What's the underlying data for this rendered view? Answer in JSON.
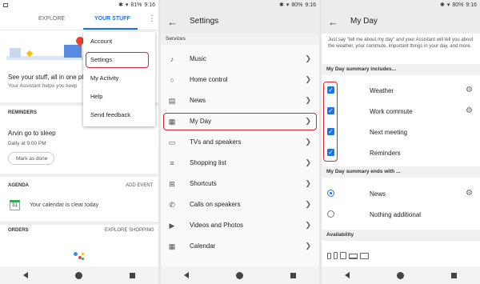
{
  "status_left": {
    "time": "9:16",
    "battery": "81%"
  },
  "status_mid": {
    "time": "9:16",
    "battery": "80%"
  },
  "status_right": {
    "time": "9:16",
    "battery": "80%"
  },
  "phone1": {
    "tabs": [
      "EXPLORE",
      "YOUR STUFF"
    ],
    "hero_text": "See your stuff, all in one pla",
    "hero_sub": "Your Assistant helps you keep",
    "reminders_title": "REMINDERS",
    "reminder_title": "Arvin go to sleep",
    "reminder_time": "Daily at 9:00 PM",
    "mark_done": "Mark as done",
    "agenda_title": "AGENDA",
    "add_event": "ADD EVENT",
    "calendar_day": "31",
    "calendar_clear": "Your calendar is clear today",
    "orders_title": "ORDERS",
    "explore_shopping": "EXPLORE SHOPPING",
    "menu": [
      "Account",
      "Settings",
      "My Activity",
      "Help",
      "Send feedback"
    ]
  },
  "phone2": {
    "title": "Settings",
    "section": "Services",
    "items": [
      {
        "label": "Music",
        "icon": "music-note"
      },
      {
        "label": "Home control",
        "icon": "lightbulb"
      },
      {
        "label": "News",
        "icon": "newspaper"
      },
      {
        "label": "My Day",
        "icon": "calendar-day"
      },
      {
        "label": "TVs and speakers",
        "icon": "cast"
      },
      {
        "label": "Shopping list",
        "icon": "list"
      },
      {
        "label": "Shortcuts",
        "icon": "add-box"
      },
      {
        "label": "Calls on speakers",
        "icon": "phone"
      },
      {
        "label": "Videos and Photos",
        "icon": "play"
      },
      {
        "label": "Calendar",
        "icon": "calendar"
      }
    ]
  },
  "phone3": {
    "title": "My Day",
    "description": "Just say \"tell me about my day\" and your Assistant will tell you about the weather, your commute, important things in your day, and more.",
    "includes_header": "My Day summary includes...",
    "includes": [
      "Weather",
      "Work commute",
      "Next meeting",
      "Reminders"
    ],
    "ends_header": "My Day summary ends with ...",
    "ends": [
      {
        "label": "News",
        "selected": true
      },
      {
        "label": "Nothing additional",
        "selected": false
      }
    ],
    "availability": "Availability"
  },
  "colors": {
    "accent": "#1a73e8",
    "highlight": "#d9262e"
  }
}
